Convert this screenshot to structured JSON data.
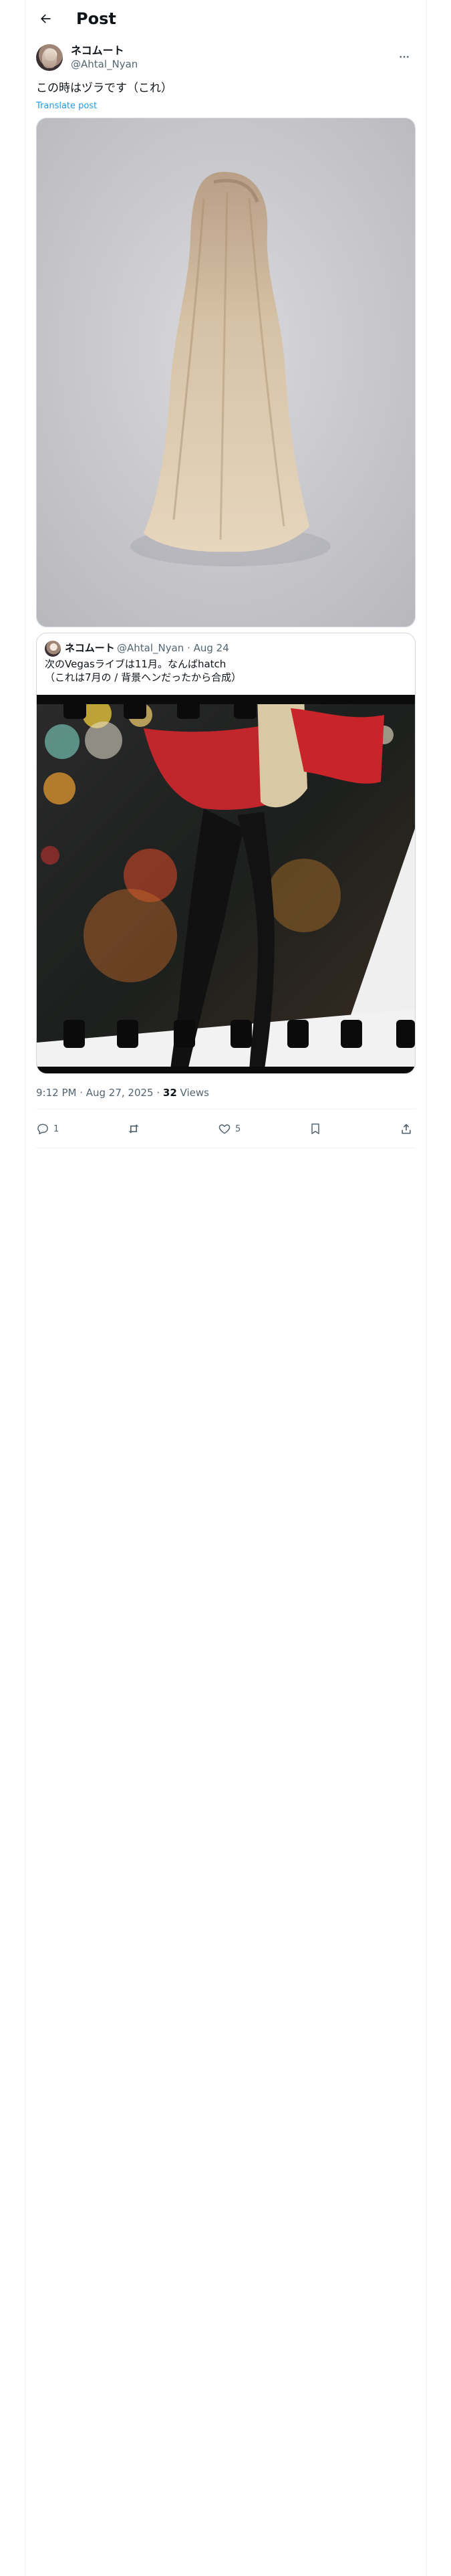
{
  "header": {
    "title": "Post"
  },
  "post": {
    "author": {
      "display_name": "ネコムート",
      "handle": "@Ahtal_Nyan"
    },
    "text": "この時はヅラです（これ）",
    "translate_label": "Translate post",
    "media": {
      "alt": "ヅラ"
    },
    "quoted": {
      "display_name": "ネコムート",
      "meta": "@Ahtal_Nyan · Aug 24",
      "text_line1": "次のVegasライブは11月。なんばhatch",
      "text_line2": "（これは7月の / 背景ヘンだったから合成）"
    },
    "time": "9:12 PM · Aug 27, 2025 · ",
    "views_count": "32",
    "views_label": " Views",
    "actions": {
      "replies": "1",
      "reposts": "",
      "likes": "5"
    }
  }
}
